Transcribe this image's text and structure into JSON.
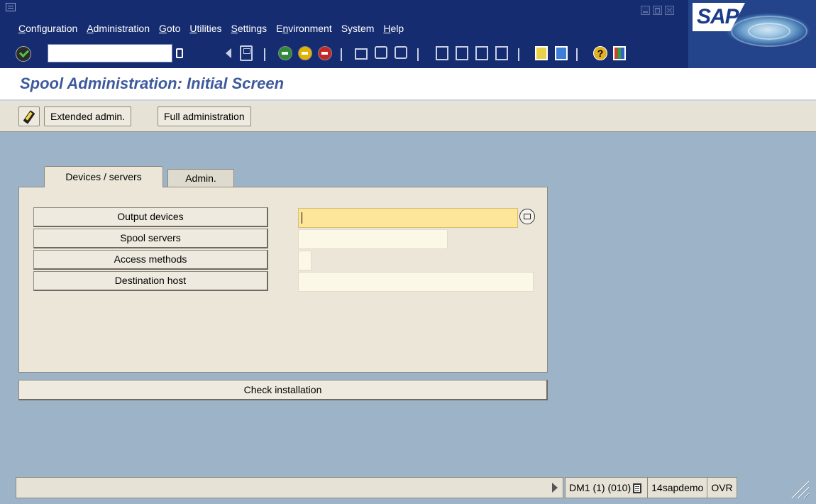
{
  "menu": {
    "items": [
      {
        "pre": "",
        "ul": "C",
        "post": "onfiguration"
      },
      {
        "pre": "",
        "ul": "A",
        "post": "dministration"
      },
      {
        "pre": "",
        "ul": "G",
        "post": "oto"
      },
      {
        "pre": "",
        "ul": "U",
        "post": "tilities"
      },
      {
        "pre": "",
        "ul": "S",
        "post": "ettings"
      },
      {
        "pre": "E",
        "ul": "n",
        "post": "vironment"
      },
      {
        "pre": "",
        "ul": "",
        "post": "System"
      },
      {
        "pre": "",
        "ul": "H",
        "post": "elp"
      }
    ]
  },
  "brand": {
    "logo_text": "SAP"
  },
  "toolbar": {
    "command_value": "",
    "help_glyph": "?"
  },
  "title": "Spool Administration: Initial Screen",
  "app_toolbar": {
    "extended_admin_label": "Extended admin.",
    "full_admin_label": "Full administration"
  },
  "tabs": {
    "devices_label": "Devices / servers",
    "admin_label": "Admin."
  },
  "panel": {
    "output_devices_label": "Output devices",
    "output_devices_value": "",
    "spool_servers_label": "Spool servers",
    "spool_servers_value": "",
    "access_methods_label": "Access methods",
    "access_methods_value": "",
    "destination_host_label": "Destination host",
    "destination_host_value": ""
  },
  "check_installation_label": "Check installation",
  "status": {
    "message": "",
    "system": "DM1 (1) (010)",
    "server": "14sapdemo",
    "mode": "OVR"
  },
  "colors": {
    "menubar": "#162c70",
    "desktop": "#9db3c7",
    "title": "#3d5a9c",
    "focus_field": "#fde59a"
  }
}
